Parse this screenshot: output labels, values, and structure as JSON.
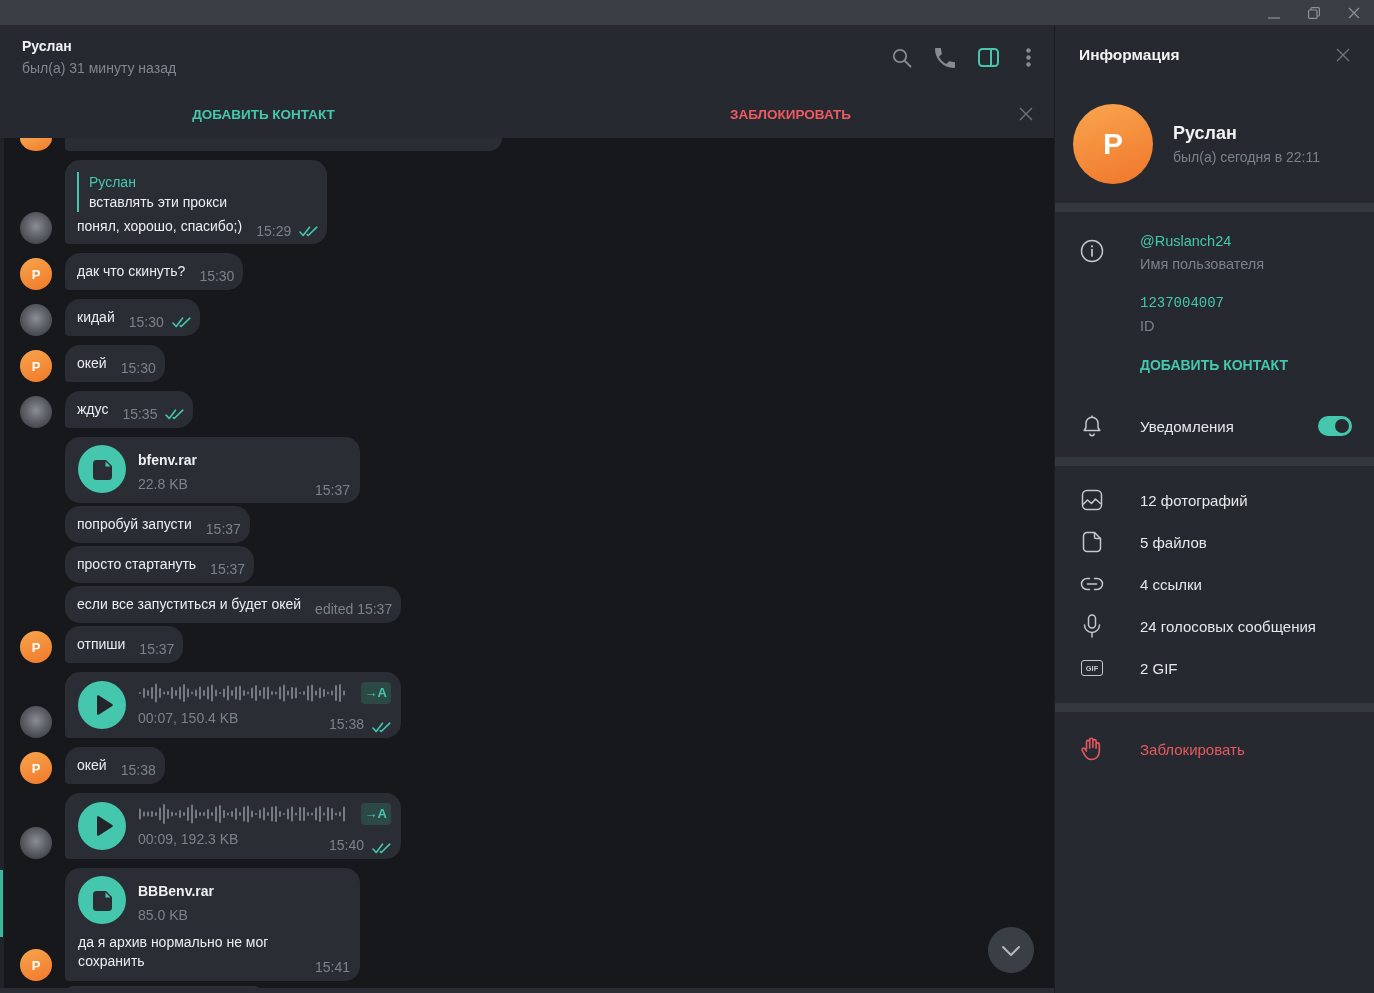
{
  "chat_header": {
    "name": "Руслан",
    "status": "был(а) 31 минуту назад",
    "tools": [
      {
        "kind": "search",
        "selected": false
      },
      {
        "kind": "call",
        "selected": false
      },
      {
        "kind": "panel",
        "selected": true
      },
      {
        "kind": "more",
        "selected": false
      }
    ]
  },
  "action_bar": {
    "add_contact": "ДОБАВИТЬ КОНТАКТ",
    "block": "ЗАБЛОКИРОВАТЬ"
  },
  "messages": [
    {
      "kind": "clipped_top",
      "avatar": {
        "kind": "letter"
      }
    },
    {
      "kind": "reply",
      "reply_to": {
        "name": "Руслан",
        "text": "вставлять эти прокси"
      },
      "text": "понял, хорошо, спасибо;)",
      "time": "15:29",
      "read": true,
      "avatar": {
        "kind": "photo"
      }
    },
    {
      "kind": "text",
      "text": "дак что скинуть?",
      "time": "15:30",
      "avatar": {
        "kind": "letter",
        "letter": "Р"
      }
    },
    {
      "kind": "text",
      "text": "кидай",
      "time": "15:30",
      "read": true,
      "avatar": {
        "kind": "photo"
      }
    },
    {
      "kind": "text",
      "text": "окей",
      "time": "15:30",
      "avatar": {
        "kind": "letter",
        "letter": "Р"
      }
    },
    {
      "kind": "text",
      "text": "ждус",
      "time": "15:35",
      "read": true,
      "avatar": {
        "kind": "photo"
      }
    },
    {
      "kind": "file",
      "file_name": "bfenv.rar",
      "size": "22.8 KB",
      "time": "15:37"
    },
    {
      "kind": "text",
      "text": "попробуй запусти",
      "time": "15:37"
    },
    {
      "kind": "text",
      "text": "просто стартануть",
      "time": "15:37"
    },
    {
      "kind": "text",
      "text": "если все запуститься и будет окей",
      "time": "edited 15:37"
    },
    {
      "kind": "text",
      "text": "отпиши",
      "time": "15:37",
      "avatar": {
        "kind": "letter",
        "letter": "Р"
      }
    },
    {
      "kind": "voice",
      "meta": "00:07, 150.4 KB",
      "transcribe": "→A",
      "time": "15:38",
      "read": true,
      "avatar": {
        "kind": "photo"
      }
    },
    {
      "kind": "text",
      "text": "окей",
      "time": "15:38",
      "avatar": {
        "kind": "letter",
        "letter": "Р"
      }
    },
    {
      "kind": "voice",
      "meta": "00:09, 192.3 KB",
      "transcribe": "→A",
      "time": "15:40",
      "read": true,
      "avatar": {
        "kind": "photo"
      }
    },
    {
      "kind": "file",
      "file_name": "BBBenv.rar",
      "size": "85.0 KB",
      "caption": "да я архив нормально не мог сохранить",
      "time": "15:41",
      "avatar": {
        "kind": "letter",
        "letter": "Р"
      }
    },
    {
      "kind": "clipped_bottom"
    }
  ],
  "info_panel": {
    "title": "Информация",
    "avatar_letter": "Р",
    "name": "Руслан",
    "status": "был(а) сегодня в 22:11",
    "details": [
      {
        "kind": "username",
        "value": "@Ruslanch24",
        "label": "Имя пользователя"
      },
      {
        "kind": "id",
        "value": "1237004007",
        "label": "ID"
      }
    ],
    "add_contact": "ДОБАВИТЬ КОНТАКТ",
    "notifications": {
      "label": "Уведомления",
      "on": true
    },
    "media": [
      {
        "kind": "photos",
        "label": "12 фотографий"
      },
      {
        "kind": "files",
        "label": "5 файлов"
      },
      {
        "kind": "links",
        "label": "4 ссылки"
      },
      {
        "kind": "voice",
        "label": "24 голосовых сообщения"
      },
      {
        "kind": "gif",
        "icon_text": "GIF",
        "label": "2 GIF"
      }
    ],
    "block": "Заблокировать"
  }
}
